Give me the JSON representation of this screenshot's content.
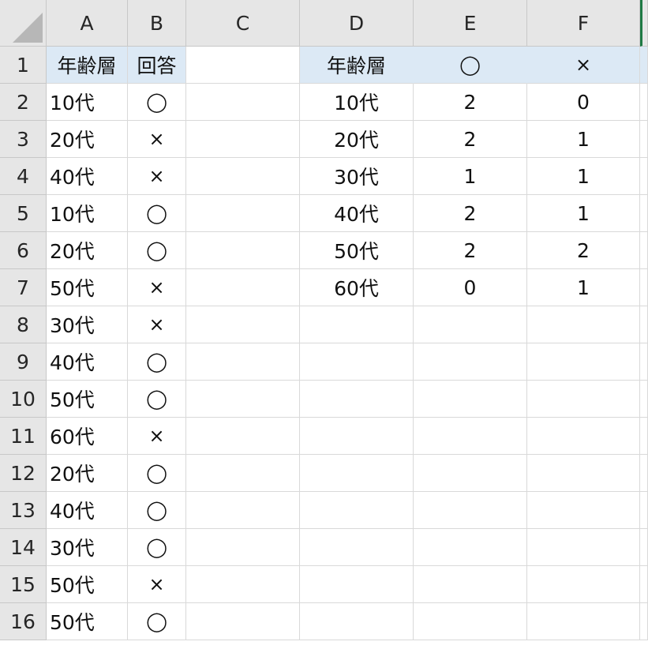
{
  "columns": [
    "A",
    "B",
    "C",
    "D",
    "E",
    "F"
  ],
  "rows": [
    "1",
    "2",
    "3",
    "4",
    "5",
    "6",
    "7",
    "8",
    "9",
    "10",
    "11",
    "12",
    "13",
    "14",
    "15",
    "16"
  ],
  "cells": {
    "A1": "年齢層",
    "B1": "回答",
    "A2": "10代",
    "B2": "◯",
    "A3": "20代",
    "B3": "×",
    "A4": "40代",
    "B4": "×",
    "A5": "10代",
    "B5": "◯",
    "A6": "20代",
    "B6": "◯",
    "A7": "50代",
    "B7": "×",
    "A8": "30代",
    "B8": "×",
    "A9": "40代",
    "B9": "◯",
    "A10": "50代",
    "B10": "◯",
    "A11": "60代",
    "B11": "×",
    "A12": "20代",
    "B12": "◯",
    "A13": "40代",
    "B13": "◯",
    "A14": "30代",
    "B14": "◯",
    "A15": "50代",
    "B15": "×",
    "A16": "50代",
    "B16": "◯",
    "D1": "年齢層",
    "E1": "◯",
    "F1": "×",
    "D2": "10代",
    "E2": "2",
    "F2": "0",
    "D3": "20代",
    "E3": "2",
    "F3": "1",
    "D4": "30代",
    "E4": "1",
    "F4": "1",
    "D5": "40代",
    "E5": "2",
    "F5": "1",
    "D6": "50代",
    "E6": "2",
    "F6": "2",
    "D7": "60代",
    "E7": "0",
    "F7": "1"
  },
  "colors": {
    "header_fill": "#dce9f5",
    "grid_header_bg": "#e6e6e6",
    "active_edge": "#1f7a45"
  },
  "icons": {
    "select_all": "select-all-triangle-icon"
  }
}
